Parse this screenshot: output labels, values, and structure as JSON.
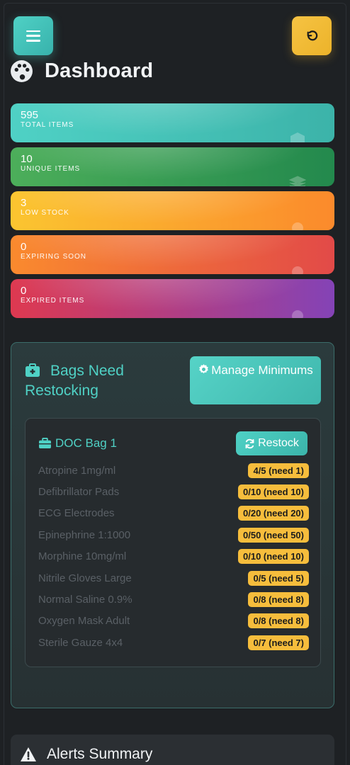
{
  "header": {
    "title": "Dashboard",
    "menu_icon": "hamburger-icon",
    "refresh_icon": "undo-icon",
    "title_icon": "palette-icon"
  },
  "stats": [
    {
      "value": "595",
      "label": "Total Items",
      "color": "#4fd1c5",
      "icon": "box-icon"
    },
    {
      "value": "10",
      "label": "Unique Items",
      "color": "#38a169",
      "icon": "layers-icon"
    },
    {
      "value": "3",
      "label": "Low Stock",
      "color": "#fbc530",
      "icon": "arrow-down-icon"
    },
    {
      "value": "0",
      "label": "Expiring Soon",
      "color": "#f6702f",
      "icon": "clock-icon"
    },
    {
      "value": "0",
      "label": "Expired Items",
      "color": "#b83e86",
      "icon": "x-circle-icon"
    }
  ],
  "restock_panel": {
    "title": "Bags Need Restocking",
    "manage_button": "Manage Minimums",
    "bag": {
      "name": "DOC Bag 1",
      "restock_button": "Restock",
      "items": [
        {
          "name": "Atropine 1mg/ml",
          "status": "4/5 (need 1)"
        },
        {
          "name": "Defibrillator Pads",
          "status": "0/10 (need 10)"
        },
        {
          "name": "ECG Electrodes",
          "status": "0/20 (need 20)"
        },
        {
          "name": "Epinephrine 1:1000",
          "status": "0/50 (need 50)"
        },
        {
          "name": "Morphine 10mg/ml",
          "status": "0/10 (need 10)"
        },
        {
          "name": "Nitrile Gloves Large",
          "status": "0/5 (need 5)"
        },
        {
          "name": "Normal Saline 0.9%",
          "status": "0/8 (need 8)"
        },
        {
          "name": "Oxygen Mask Adult",
          "status": "0/8 (need 8)"
        },
        {
          "name": "Sterile Gauze 4x4",
          "status": "0/7 (need 7)"
        }
      ]
    }
  },
  "alerts": {
    "title": "Alerts Summary"
  },
  "colors": {
    "accent": "#4fd1c5",
    "warning": "#f6bd3c",
    "background": "#1e2124"
  }
}
